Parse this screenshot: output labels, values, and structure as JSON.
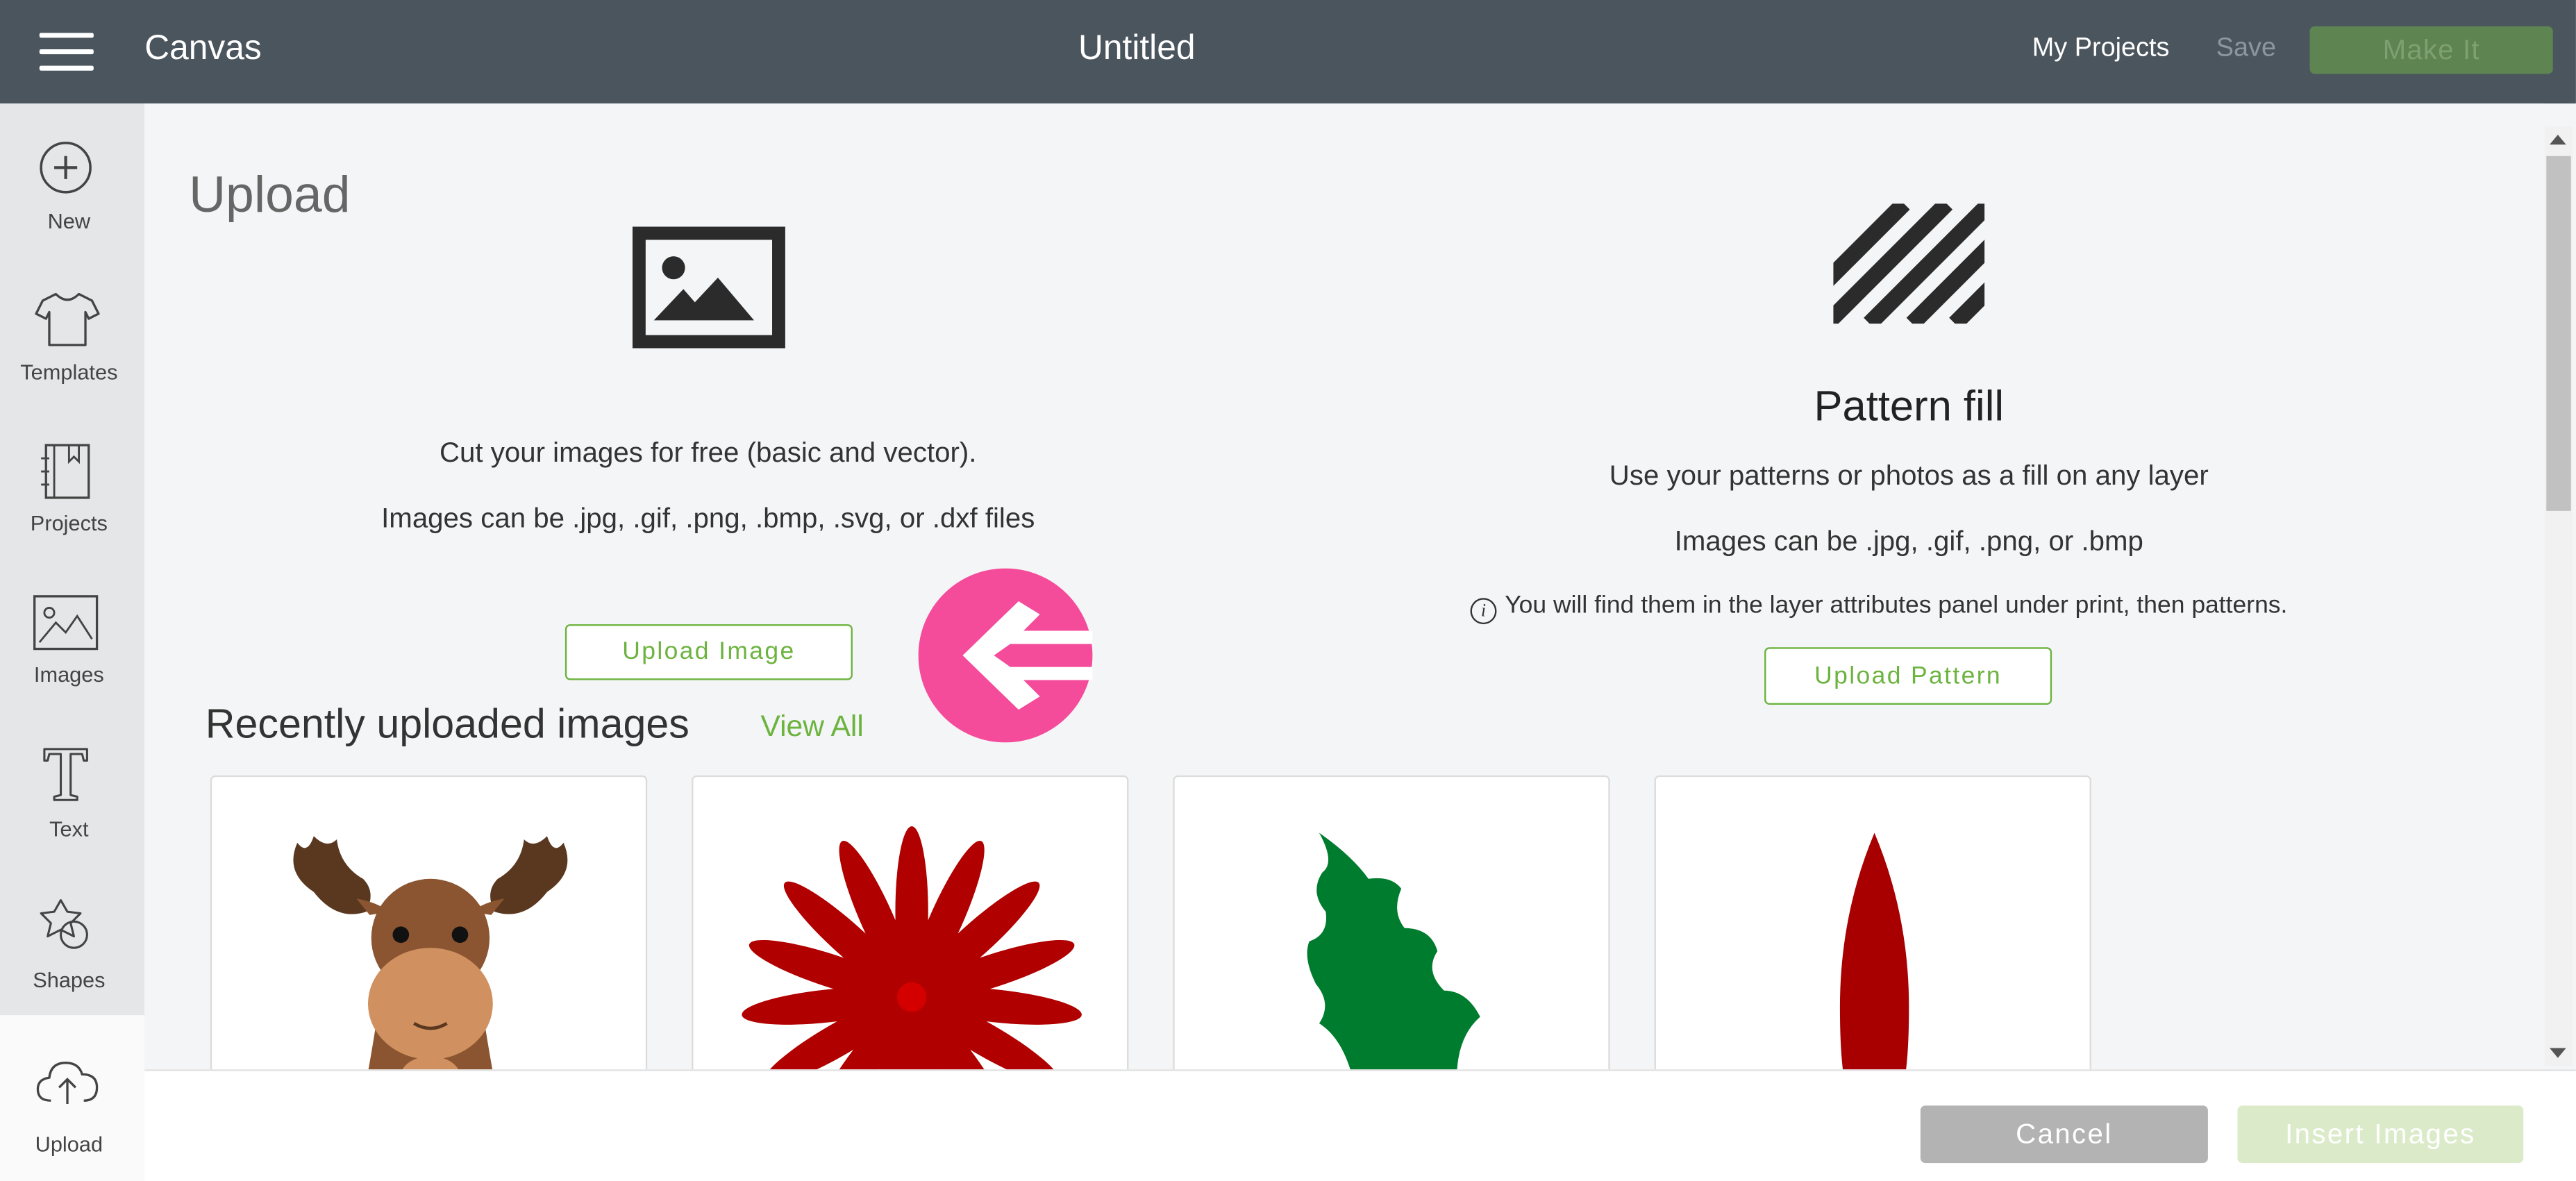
{
  "header": {
    "app_title": "Canvas",
    "doc_title": "Untitled",
    "my_projects": "My Projects",
    "save": "Save",
    "make_it": "Make It"
  },
  "sidebar": {
    "items": [
      {
        "label": "New",
        "icon": "plus-circle-icon"
      },
      {
        "label": "Templates",
        "icon": "t-shirt-icon"
      },
      {
        "label": "Projects",
        "icon": "notebook-icon"
      },
      {
        "label": "Images",
        "icon": "image-icon"
      },
      {
        "label": "Text",
        "icon": "text-t-icon"
      },
      {
        "label": "Shapes",
        "icon": "shapes-icon"
      },
      {
        "label": "Upload",
        "icon": "cloud-upload-icon"
      }
    ],
    "active": "Upload"
  },
  "upload": {
    "heading": "Upload",
    "image_section": {
      "line1": "Cut your images for free (basic and vector).",
      "line2": "Images can be .jpg, .gif, .png, .bmp, .svg, or .dxf files",
      "button": "Upload Image"
    },
    "pattern_section": {
      "title": "Pattern fill",
      "line1": "Use your patterns or photos as a fill on any layer",
      "line2": "Images can be .jpg, .gif, .png, or .bmp",
      "info_icon": "i",
      "info": "You will find them in the layer attributes panel under print, then patterns.",
      "button": "Upload Pattern"
    },
    "recent": {
      "heading": "Recently uploaded images",
      "view_all": "View All",
      "thumbnails": [
        {
          "subject": "moose"
        },
        {
          "subject": "red-poinsettia"
        },
        {
          "subject": "green-holly-leaf"
        },
        {
          "subject": "red-petal"
        }
      ]
    }
  },
  "footer": {
    "cancel": "Cancel",
    "insert": "Insert Images"
  },
  "colors": {
    "header_bg": "#4b555e",
    "accent_green": "#6cb33f",
    "make_it_bg": "#5e8451",
    "pink_arrow": "#f44b9a"
  }
}
